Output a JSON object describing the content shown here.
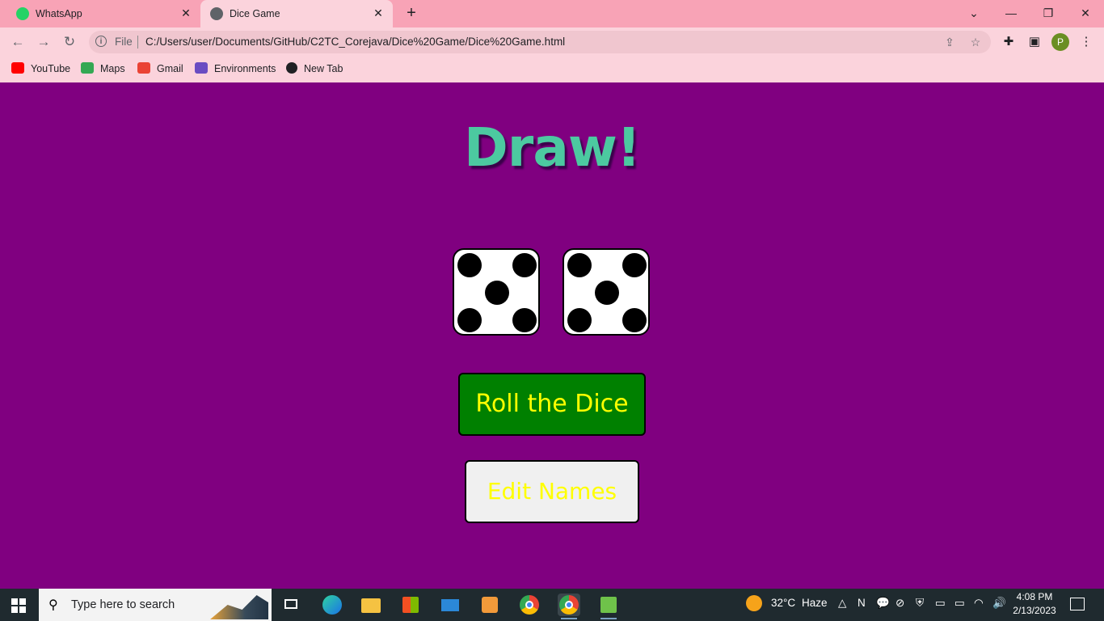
{
  "browser": {
    "tabs": [
      {
        "title": "WhatsApp",
        "icon": "whatsapp-icon",
        "active": false
      },
      {
        "title": "Dice Game",
        "icon": "globe-icon",
        "active": true
      }
    ],
    "address": {
      "scheme_label": "File",
      "url": "C:/Users/user/Documents/GitHub/C2TC_Corejava/Dice%20Game/Dice%20Game.html"
    },
    "profile_initial": "P",
    "bookmarks": [
      {
        "label": "YouTube",
        "icon": "youtube-icon",
        "color": "#ff0000"
      },
      {
        "label": "Maps",
        "icon": "maps-icon",
        "color": "#34a853"
      },
      {
        "label": "Gmail",
        "icon": "gmail-icon",
        "color": "#ea4335"
      },
      {
        "label": "Environments",
        "icon": "environments-icon",
        "color": "#6a4cc2"
      },
      {
        "label": "New Tab",
        "icon": "globe-icon",
        "color": "#202124"
      }
    ]
  },
  "game": {
    "heading": "Draw!",
    "dice": [
      5,
      5
    ],
    "roll_button": "Roll the Dice",
    "edit_button": "Edit Names",
    "colors": {
      "background": "#800080",
      "heading": "#4cc9a0",
      "roll_bg": "#008000",
      "button_text": "#ffff00",
      "edit_bg": "#f0f0f0"
    }
  },
  "taskbar": {
    "search_placeholder": "Type here to search",
    "weather": {
      "temp": "32°C",
      "condition": "Haze"
    },
    "time": "4:08 PM",
    "date": "2/13/2023"
  }
}
